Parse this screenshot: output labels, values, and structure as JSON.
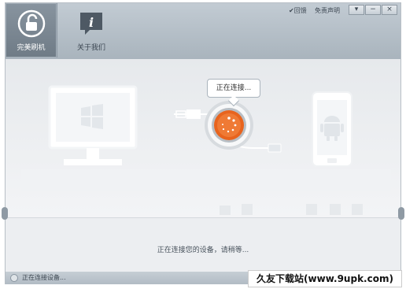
{
  "nav": {
    "items": [
      {
        "label": "完美刷机",
        "icon": "unlock-icon",
        "active": true
      },
      {
        "label": "关于我们",
        "icon": "info-icon",
        "active": false
      }
    ]
  },
  "window_controls": {
    "feedback": "✔回馈",
    "disclaimer": "免责声明",
    "menu": "▾",
    "minimize": "−",
    "close": "×"
  },
  "connection": {
    "tooltip": "正在连接...",
    "message": "正在连接您的设备，请稍等..."
  },
  "statusbar": {
    "text": "正在连接设备..."
  },
  "watermark": {
    "text": "久友下载站(www.9upk.com)"
  },
  "colors": {
    "accent": "#e8641e",
    "topbar": "#b6c0c9",
    "content_bg": "#eef0f2"
  }
}
